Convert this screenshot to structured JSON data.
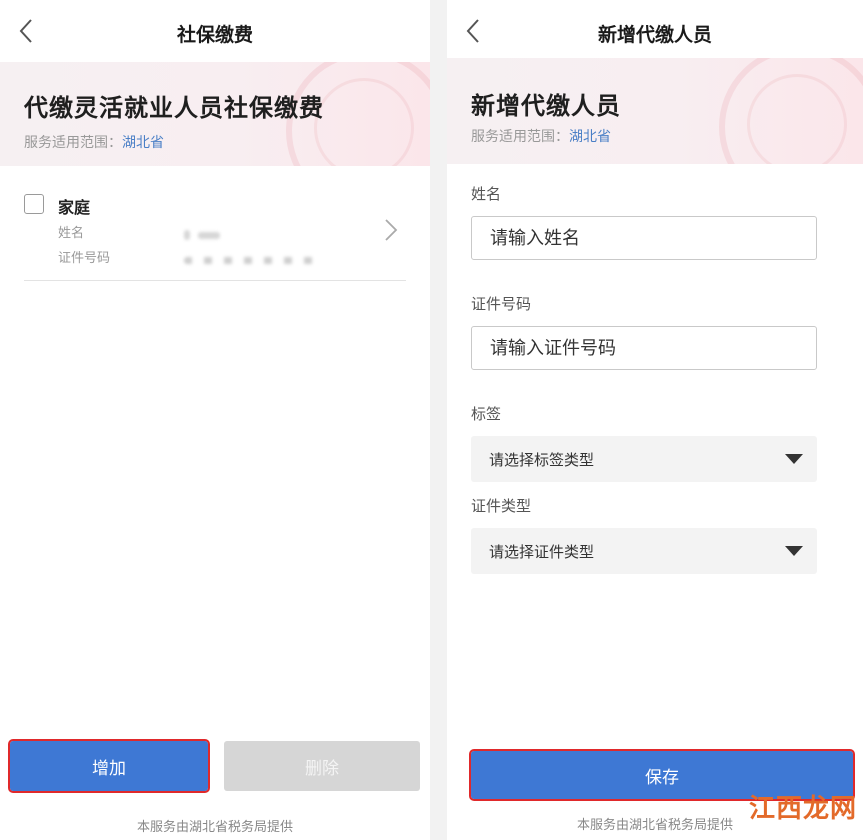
{
  "left": {
    "nav_title": "社保缴费",
    "banner_title": "代缴灵活就业人员社保缴费",
    "scope_label": "服务适用范围：",
    "scope_value": "湖北省",
    "card": {
      "title": "家庭",
      "name_label": "姓名",
      "id_label": "证件号码"
    },
    "add_button": "增加",
    "delete_button": "删除",
    "footer": "本服务由湖北省税务局提供"
  },
  "right": {
    "nav_title": "新增代缴人员",
    "banner_title": "新增代缴人员",
    "scope_label": "服务适用范围：",
    "scope_value": "湖北省",
    "name_label": "姓名",
    "name_placeholder": "请输入姓名",
    "id_label": "证件号码",
    "id_placeholder": "请输入证件号码",
    "tag_label": "标签",
    "tag_select": "请选择标签类型",
    "id_type_label": "证件类型",
    "id_type_select": "请选择证件类型",
    "save_button": "保存",
    "footer": "本服务由湖北省税务局提供"
  },
  "watermark": "江西龙网",
  "icons": {
    "back": "chevron-left-icon",
    "forward": "chevron-right-icon",
    "dropdown": "caret-down-icon",
    "checkbox": "checkbox-icon"
  },
  "colors": {
    "primary": "#3e78d4",
    "highlight_border": "#e0292b",
    "disabled": "#d6d6d6",
    "link": "#4a7fc6"
  }
}
